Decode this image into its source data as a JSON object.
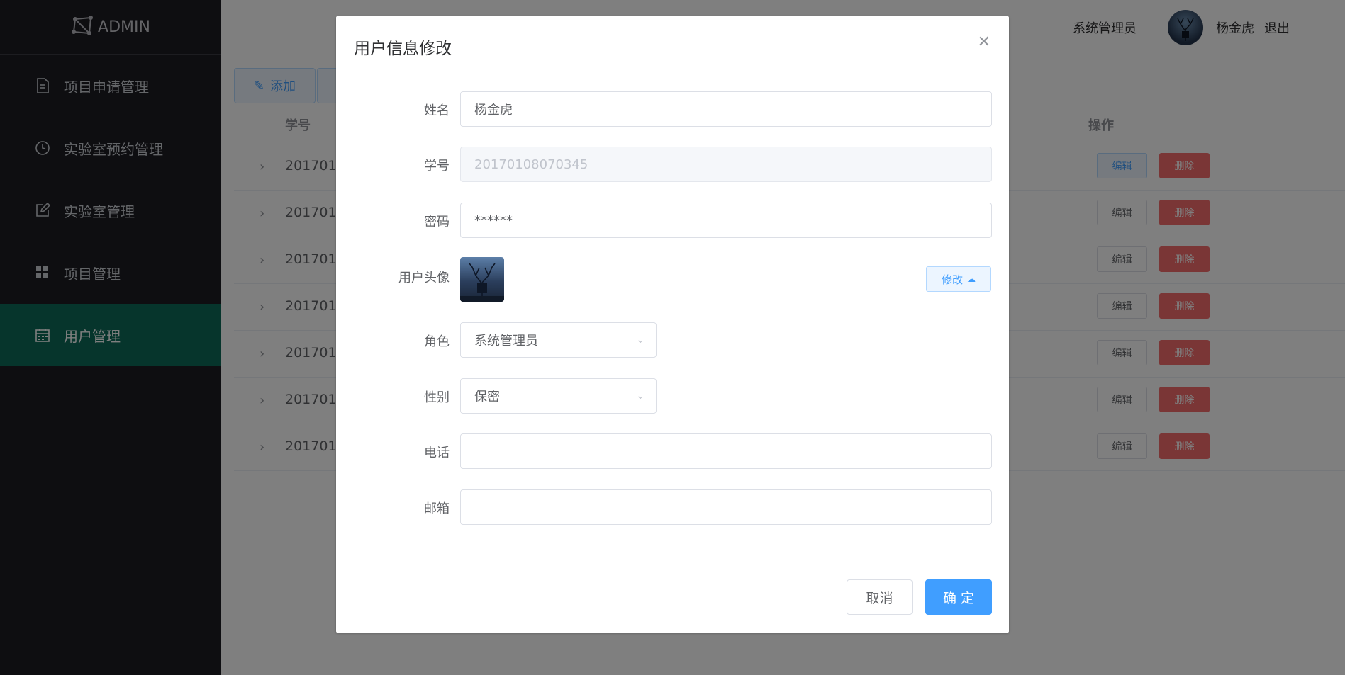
{
  "app": {
    "logo_text": "ADMIN"
  },
  "sidebar": {
    "items": [
      {
        "label": "项目申请管理",
        "icon": "document-icon",
        "active": false
      },
      {
        "label": "实验室预约管理",
        "icon": "clock-icon",
        "active": false
      },
      {
        "label": "实验室管理",
        "icon": "edit-square-icon",
        "active": false
      },
      {
        "label": "项目管理",
        "icon": "grid-icon",
        "active": false
      },
      {
        "label": "用户管理",
        "icon": "calendar-icon",
        "active": true
      }
    ]
  },
  "header": {
    "role": "系统管理员",
    "username": "杨金虎",
    "logout_label": "退出"
  },
  "toolbar": {
    "add_label": "添加"
  },
  "table": {
    "columns": {
      "id": "学号",
      "actions": "操作"
    },
    "rows": [
      {
        "id": "2017010"
      },
      {
        "id": "2017010"
      },
      {
        "id": "2017010"
      },
      {
        "id": "2017010"
      },
      {
        "id": "2017010"
      },
      {
        "id": "2017010"
      },
      {
        "id": "2017010"
      }
    ],
    "edit_label": "编辑",
    "delete_label": "删除"
  },
  "dialog": {
    "title": "用户信息修改",
    "fields": {
      "name": {
        "label": "姓名",
        "value": "杨金虎"
      },
      "student_id": {
        "label": "学号",
        "value": "20170108070345"
      },
      "password": {
        "label": "密码",
        "value": "******"
      },
      "avatar": {
        "label": "用户头像",
        "upload_label": "修改"
      },
      "role": {
        "label": "角色",
        "value": "系统管理员"
      },
      "gender": {
        "label": "性别",
        "value": "保密"
      },
      "phone": {
        "label": "电话",
        "value": ""
      },
      "email": {
        "label": "邮箱",
        "value": ""
      }
    },
    "cancel_label": "取消",
    "confirm_label": "确 定"
  },
  "colors": {
    "sidebar_bg": "#1c1c22",
    "sidebar_active": "#0c6b58",
    "primary": "#409eff",
    "danger": "#f56c6c"
  }
}
